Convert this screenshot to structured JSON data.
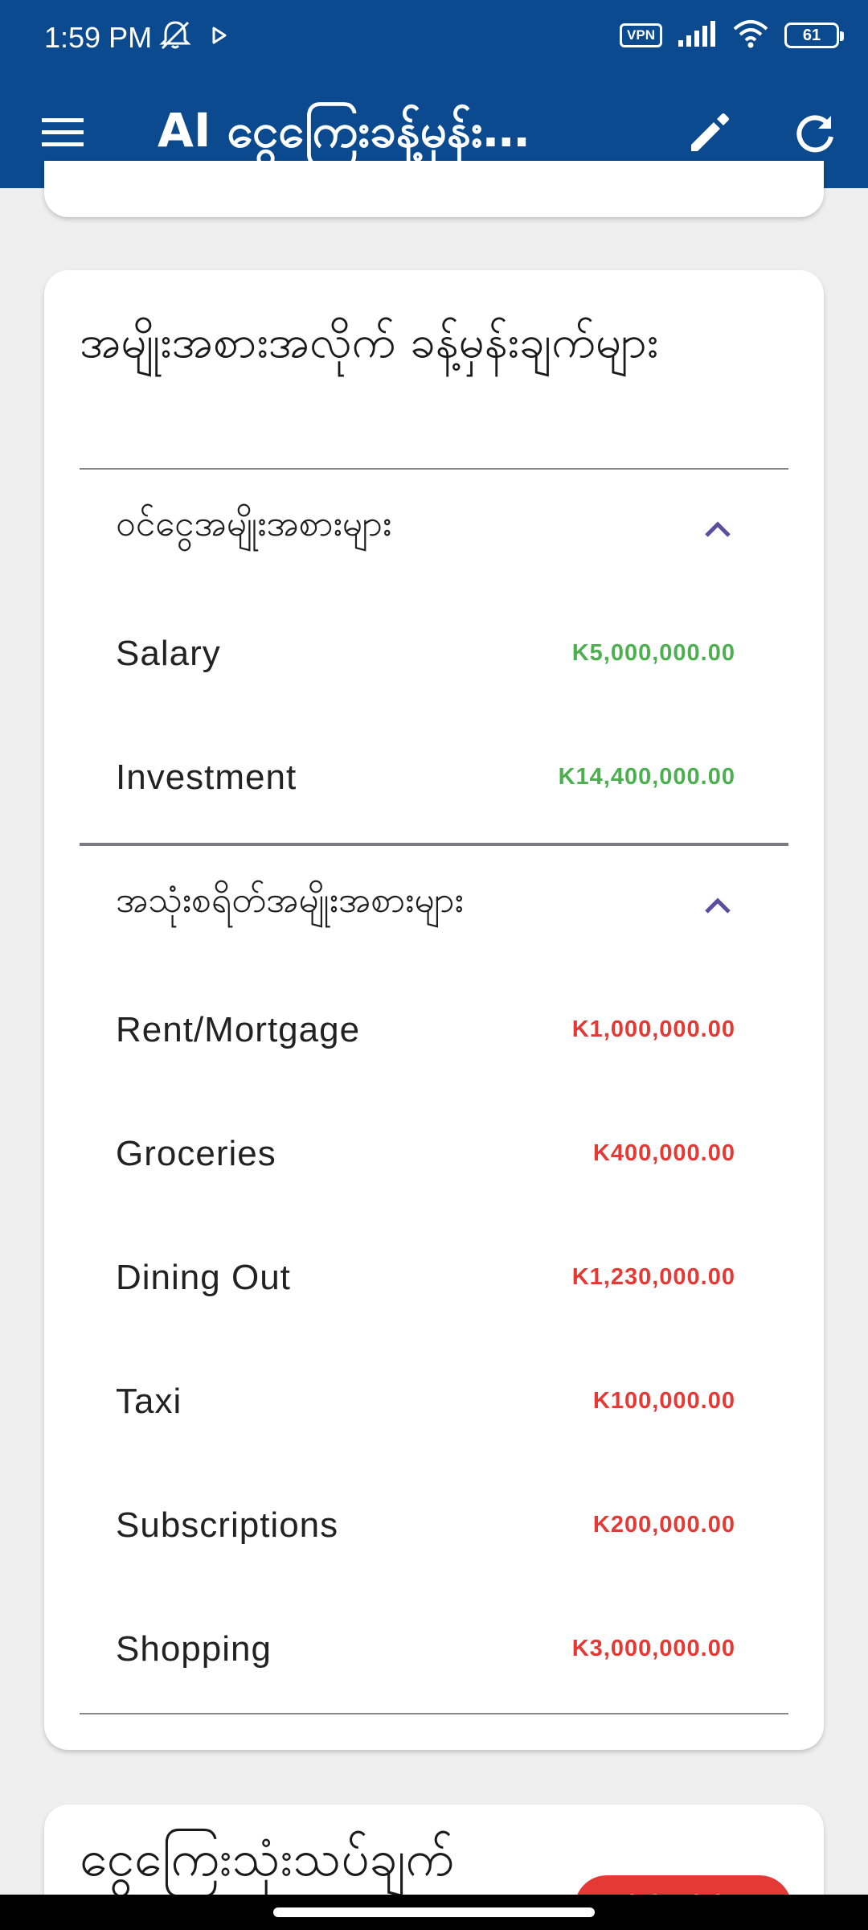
{
  "status_bar": {
    "time": "1:59 PM",
    "icons": [
      "mute-icon",
      "play-icon"
    ],
    "vpn": "VPN",
    "battery": "61"
  },
  "app_bar": {
    "title": "AI ငွေကြေးခန့်မှန်း…"
  },
  "category_card": {
    "title": "အမျိုးအစားအလိုက် ခန့်မှန်းချက်များ",
    "income_section": {
      "label": "ဝင်ငွေအမျိုးအစားများ",
      "items": [
        {
          "label": "Salary",
          "amount": "K5,000,000.00"
        },
        {
          "label": "Investment",
          "amount": "K14,400,000.00"
        }
      ]
    },
    "expense_section": {
      "label": "အသုံးစရိတ်အမျိုးအစားများ",
      "items": [
        {
          "label": "Rent/Mortgage",
          "amount": "K1,000,000.00"
        },
        {
          "label": "Groceries",
          "amount": "K400,000.00"
        },
        {
          "label": "Dining Out",
          "amount": "K1,230,000.00"
        },
        {
          "label": "Taxi",
          "amount": "K100,000.00"
        },
        {
          "label": "Subscriptions",
          "amount": "K200,000.00"
        },
        {
          "label": "Shopping",
          "amount": "K3,000,000.00"
        }
      ]
    }
  },
  "bottom_card": {
    "title": "ငွေကြေးသုံးသပ်ချက်",
    "badge": "High Risk"
  },
  "colors": {
    "app_bar": "#0b4a8f",
    "income": "#4caf50",
    "expense": "#e53935",
    "chevron": "#5c4e9e"
  }
}
